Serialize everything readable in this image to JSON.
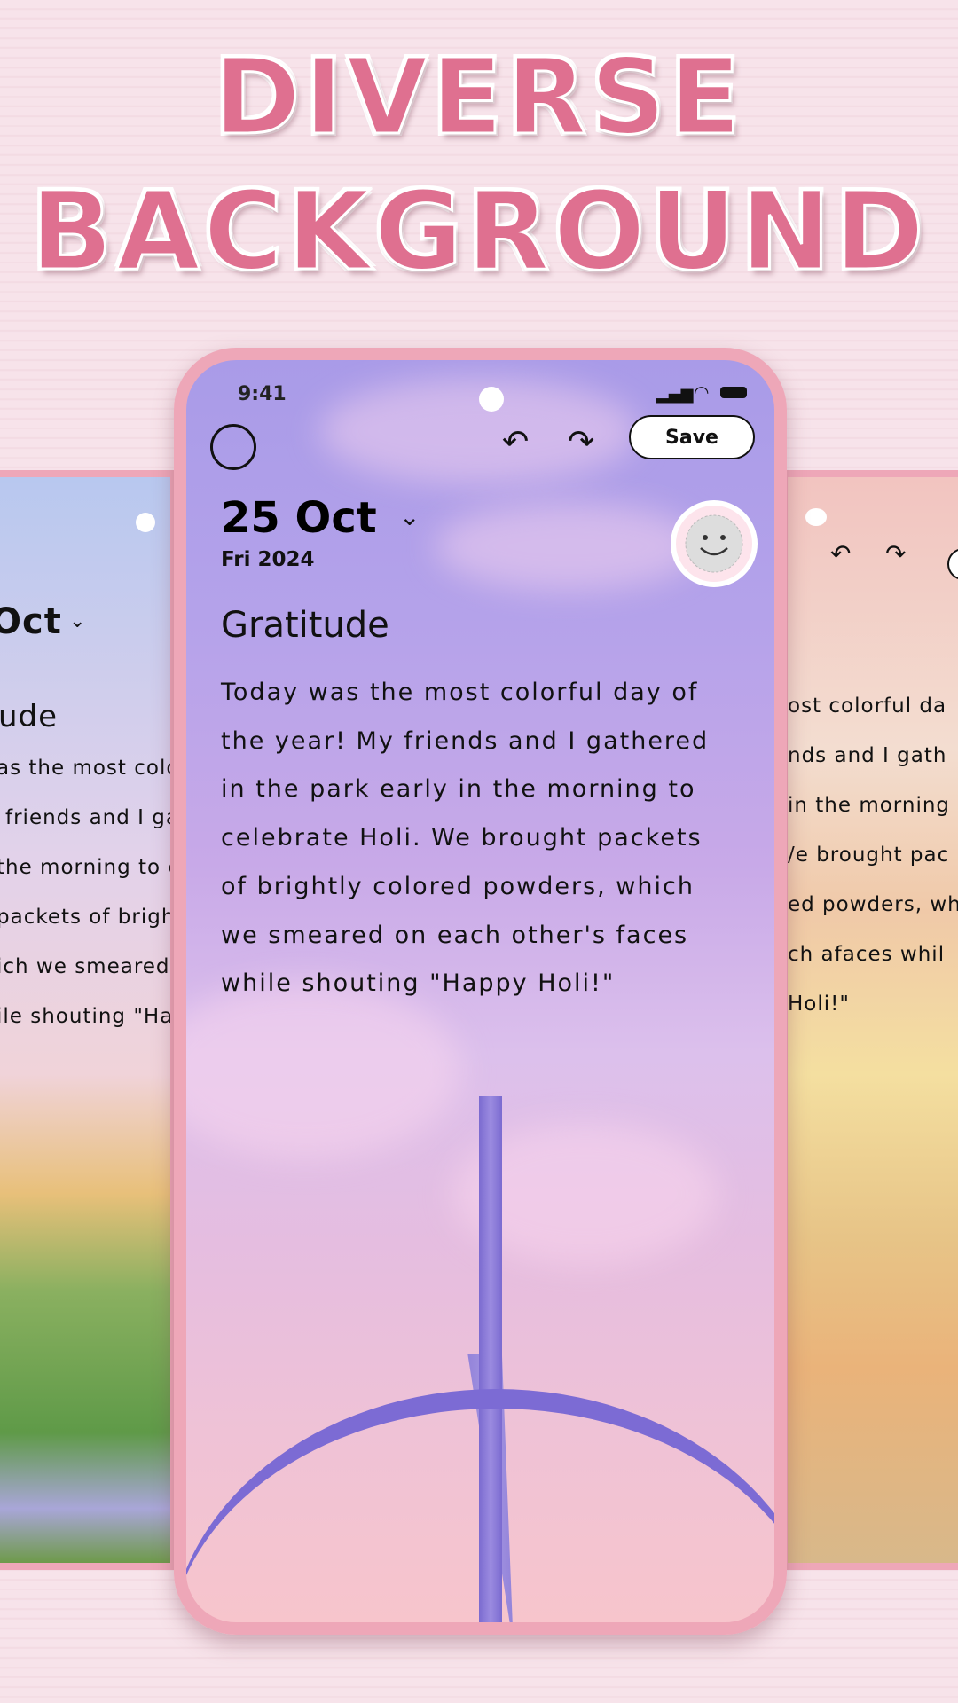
{
  "headline": {
    "line1": "DIVERSE",
    "line2": "BACKGROUND"
  },
  "colors": {
    "title": "#df7090",
    "frame": "#eea7b8",
    "phone_bg": "#b4a2ea"
  },
  "left_card": {
    "date": "Oct",
    "title": "ude",
    "lines": [
      "as the most color",
      "friends and I ga",
      "the morning to ce",
      "packets of bright",
      "ich we smeared o",
      "ile shouting \"Hap"
    ]
  },
  "right_card": {
    "lines": [
      "ost colorful da",
      "nds and I gath",
      "in the morning",
      "/e brought pac",
      "ed powders, wh",
      "ch afaces whil",
      "Holi!\""
    ]
  },
  "phone": {
    "status": {
      "time": "9:41",
      "icons": [
        "signal-icon",
        "wifi-icon",
        "battery-icon"
      ]
    },
    "toolbar": {
      "save_label": "Save",
      "icons": [
        "circle-icon",
        "undo-icon",
        "redo-icon"
      ]
    },
    "date": "25 Oct",
    "subdate": "Fri 2024",
    "mood_icon": "smiley-icon",
    "entry_title": "Gratitude",
    "entry_lines": [
      "Today was the most colorful day of",
      "the year! My friends and I gathered",
      "in the park early in the morning to",
      "celebrate Holi. We brought packets",
      "of brightly colored powders, which",
      "we smeared on each other's faces",
      "while shouting \"Happy Holi!\""
    ]
  }
}
